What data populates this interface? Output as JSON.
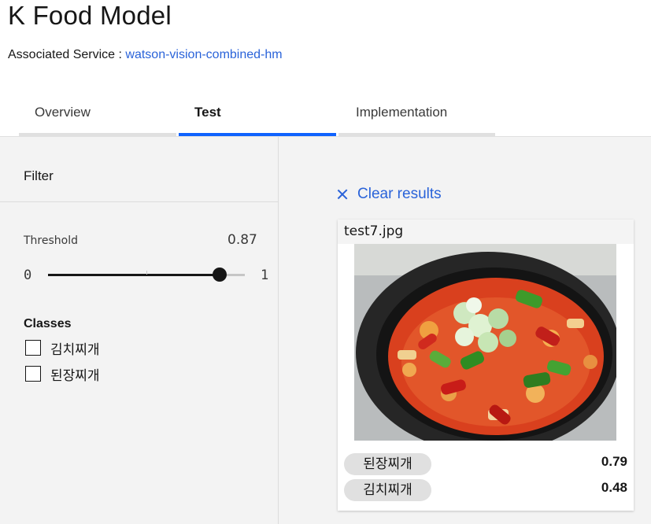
{
  "header": {
    "title": "K Food Model",
    "service_prefix": "Associated Service : ",
    "service_name": "watson-vision-combined-hm"
  },
  "tabs": [
    {
      "label": "Overview",
      "active": false
    },
    {
      "label": "Test",
      "active": true
    },
    {
      "label": "Implementation",
      "active": false
    }
  ],
  "filter": {
    "title": "Filter",
    "threshold_label": "Threshold",
    "threshold_value": "0.87",
    "threshold_fraction": 0.87,
    "min": "0",
    "max": "1",
    "classes_title": "Classes",
    "classes": [
      {
        "label": "김치찌개",
        "checked": false
      },
      {
        "label": "된장찌개",
        "checked": false
      }
    ]
  },
  "results": {
    "clear_label": "Clear results",
    "card": {
      "filename": "test7.jpg",
      "scores": [
        {
          "label": "된장찌개",
          "score": "0.79"
        },
        {
          "label": "김치찌개",
          "score": "0.48"
        }
      ]
    }
  },
  "colors": {
    "accent": "#0f62fe",
    "link": "#2a63d9",
    "background": "#f3f3f3"
  }
}
